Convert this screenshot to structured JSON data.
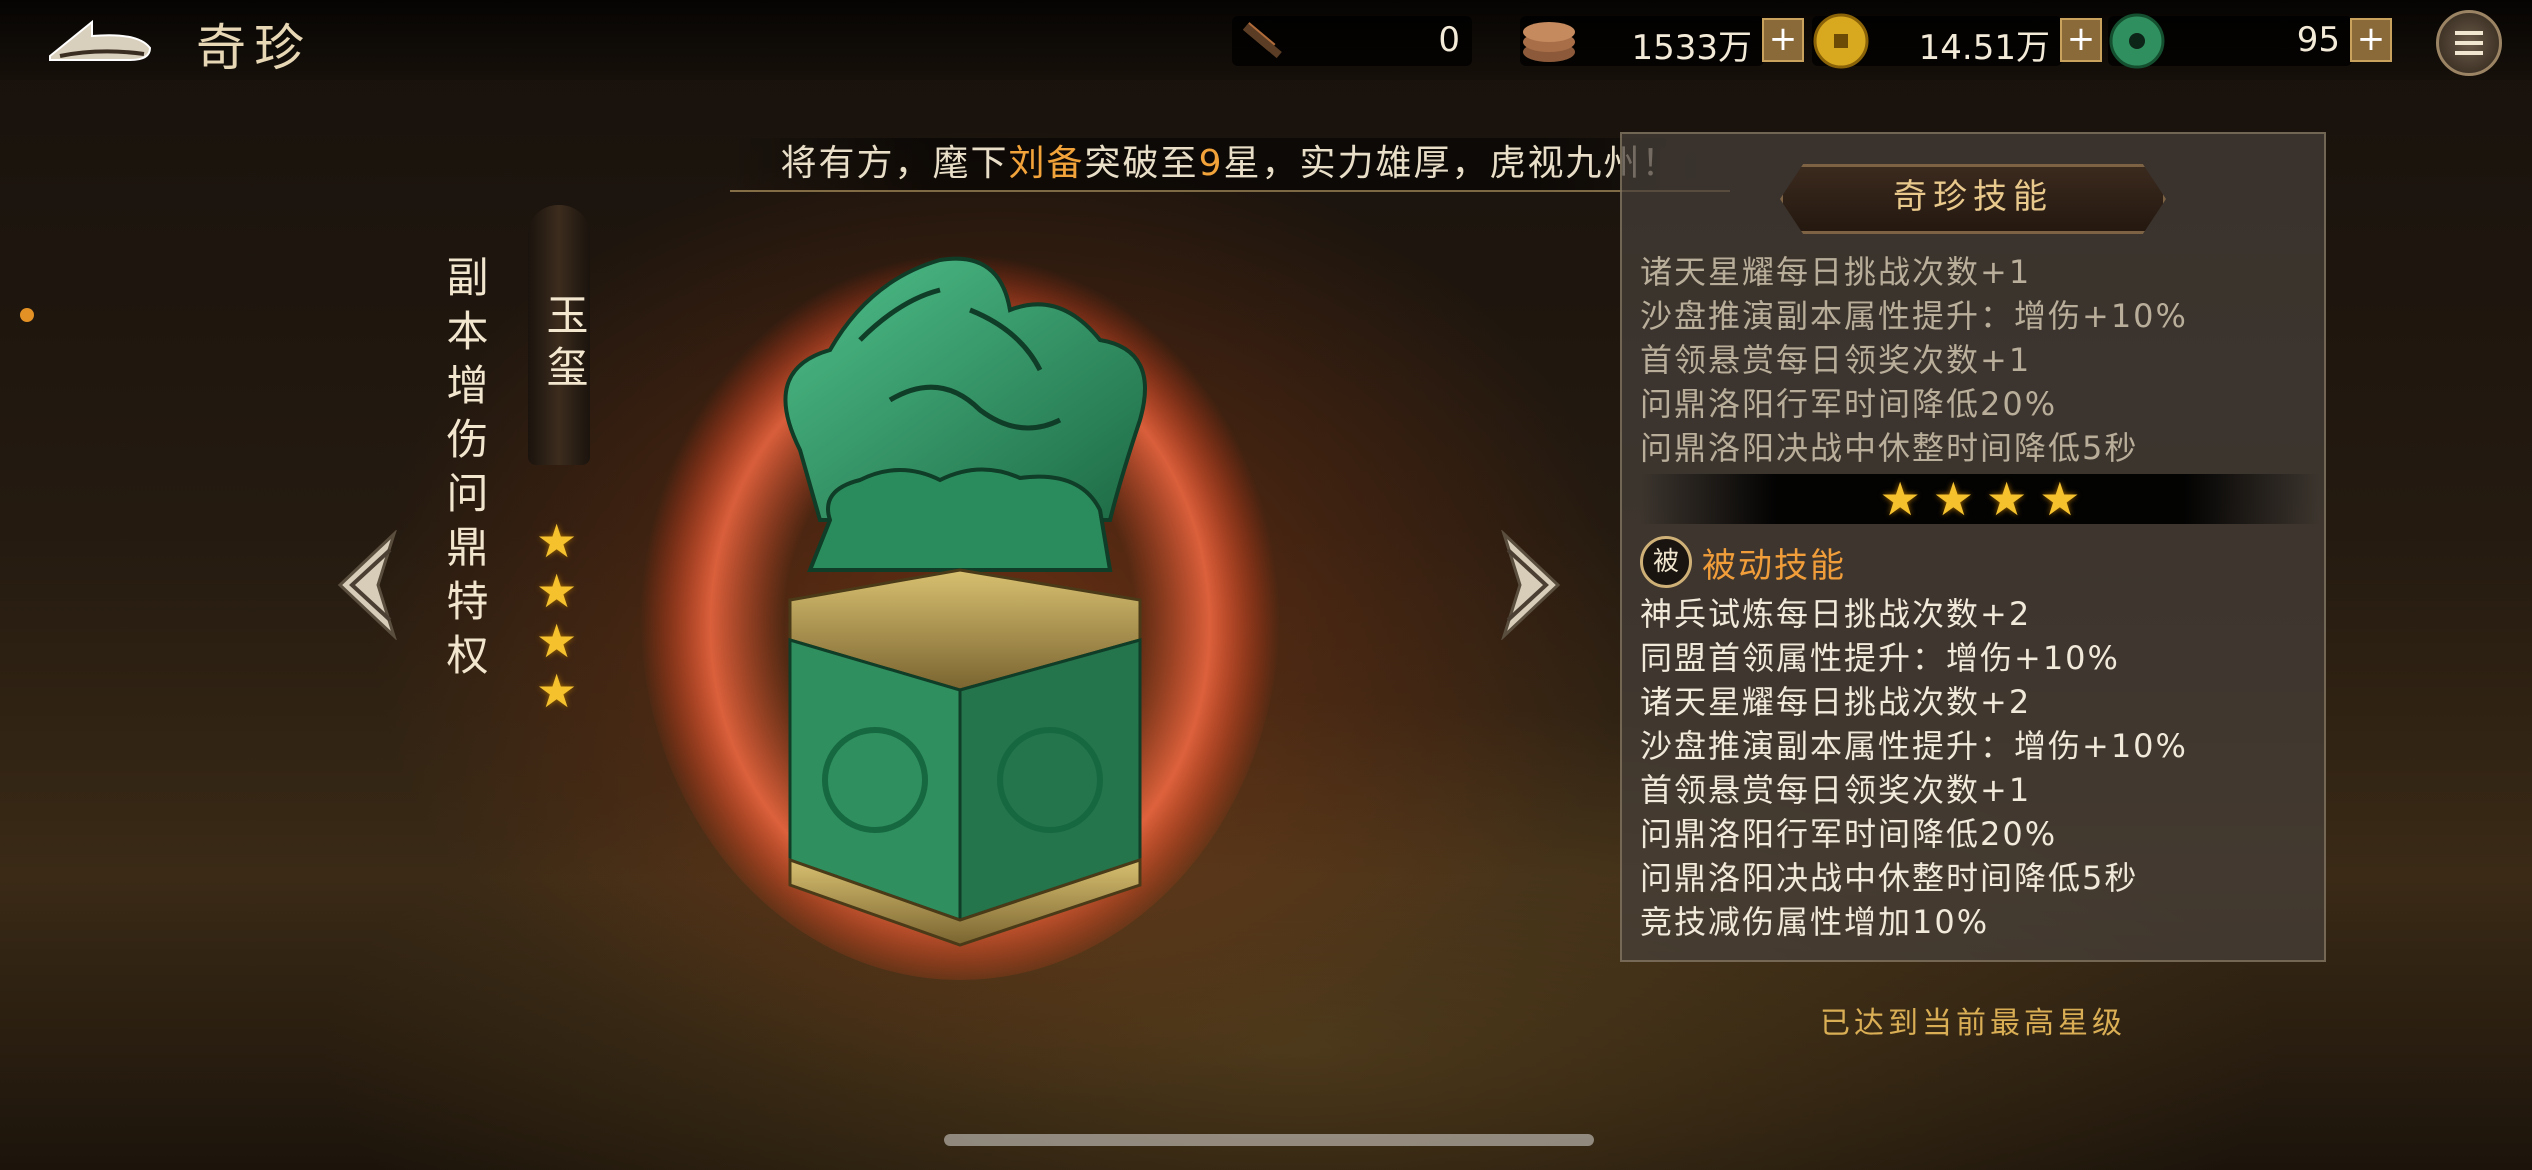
{
  "header": {
    "title": "奇珍"
  },
  "resources": [
    {
      "icon": "hammer-icon",
      "value": "0",
      "has_plus": false
    },
    {
      "icon": "copper-coins-icon",
      "value": "1533万",
      "has_plus": true
    },
    {
      "icon": "gold-coin-icon",
      "value": "14.51万",
      "has_plus": true
    },
    {
      "icon": "jade-coin-icon",
      "value": "95",
      "has_plus": true
    }
  ],
  "announcement": {
    "before": "将有方，麾下",
    "general": "刘备",
    "mid": "突破至",
    "stars": "9",
    "after": "星，实力雄厚，虎视九州！"
  },
  "treasure": {
    "type_label": "副本增伤问鼎特权",
    "name": "玉玺",
    "star_count": 4,
    "star_glyph": "★"
  },
  "skill_panel": {
    "title": "奇珍技能",
    "previous_level_lines": [
      "诸天星耀每日挑战次数+1",
      "沙盘推演副本属性提升：增伤+10%",
      "首领悬赏每日领奖次数+1",
      "问鼎洛阳行军时间降低20%",
      "问鼎洛阳决战中休整时间降低5秒"
    ],
    "current_stars": 4,
    "passive_badge": "被",
    "passive_title": "被动技能",
    "current_lines": [
      "神兵试炼每日挑战次数+2",
      "同盟首领属性提升：增伤+10%",
      "诸天星耀每日挑战次数+2",
      "沙盘推演副本属性提升：增伤+10%",
      "首领悬赏每日领奖次数+1",
      "问鼎洛阳行军时间降低20%",
      "问鼎洛阳决战中休整时间降低5秒",
      "竞技减伤属性增加10%"
    ]
  },
  "max_level_note": "已达到当前最高星级",
  "colors": {
    "accent_orange": "#f2a33a",
    "star_gold": "#f5c22e",
    "jade": "#2f8f5e"
  }
}
